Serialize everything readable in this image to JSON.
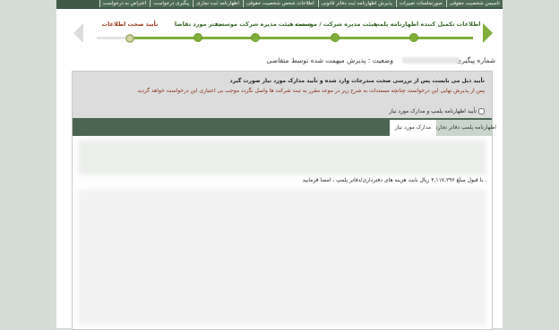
{
  "top_nav": {
    "tabs": [
      "تاسیس شخصیت حقوقی",
      "صورتجلسات تغییرات",
      "پذیرش اظهارنامه ثبت دفاتر قانونی",
      "اطلاعات شخص شخصیت حقوقی",
      "اظهارنامه ثبت تجاری",
      "پیگیری درخواست",
      "اعتراض به درخواست"
    ]
  },
  "wizard": {
    "steps": [
      {
        "label": "اطلاعات تکمیل کننده اظهارنامه پلمپ"
      },
      {
        "label": "هیئت مدیره شرکت / موسسه"
      },
      {
        "label": "سمت هیئت مدیره شرکت موسسه"
      },
      {
        "label": "دفتر مورد تقاضا"
      },
      {
        "label": "تأیید صحت اطلاعات"
      }
    ]
  },
  "info": {
    "tracking_label": "شماره پیگیری",
    "status_text": "وضعیت : پذیرش میهمت شده توسط متقاضی"
  },
  "notice": {
    "line1": "تأیید ذیل می بایست پس از بررسی صحت مندرجات وارد شده و تأیید مدارک مورد نیاز صورت گیرد",
    "line2": "پس از پذیرش نهایی این درخواست چنانچه مستندات به شرح زیر در موعد مقرر به ثبت شرکت ها واصل نگردد موجب بی اعتباری این درخواست خواهد گردید",
    "checkbox_label": "تأیید اظهارنامه پلمپ و مدارک مورد نیاز",
    "tabs": [
      {
        "label": "اظهارنامه پلمپ دفاتر تجاری"
      },
      {
        "label": "مدارک مورد نیاز"
      }
    ],
    "amount_text": "با قبول مبلغ ۳,۱۱۷,۲۹۶ ریال بابت هزینه های دفترداری/دفاتر پلمپ ، امضا فرمایید ."
  }
}
